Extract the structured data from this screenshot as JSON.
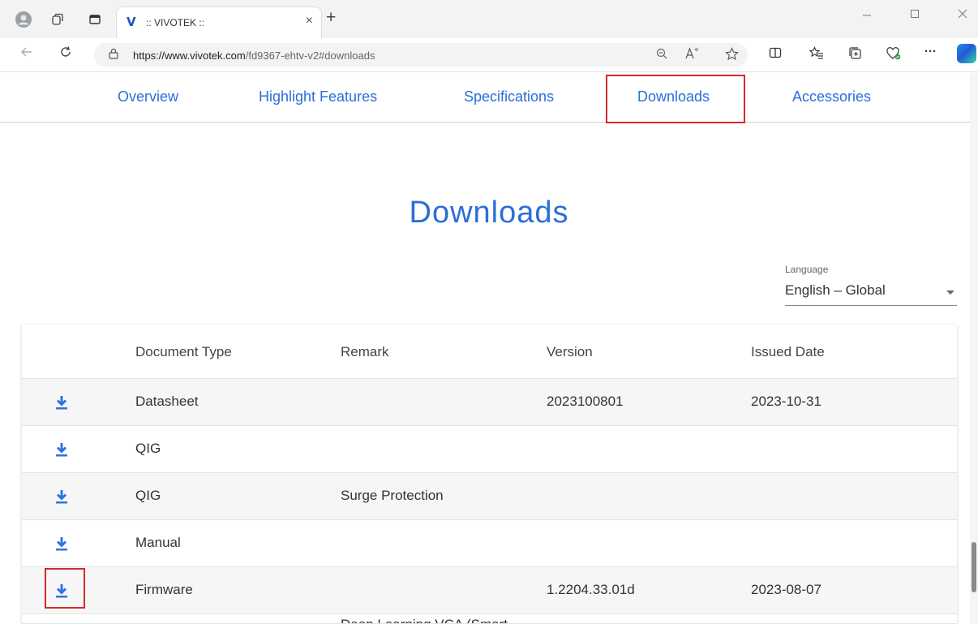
{
  "browser": {
    "tab_logo": "V",
    "tab_title": ":: VIVOTEK ::",
    "tab_close": "×",
    "new_tab": "+",
    "url_host": "https://www.vivotek.com",
    "url_path": "/fd9367-ehtv-v2#downloads",
    "more_tools": "···"
  },
  "site_nav": [
    "Overview",
    "Highlight Features",
    "Specifications",
    "Downloads",
    "Accessories"
  ],
  "page": {
    "heading": "Downloads"
  },
  "language": {
    "label": "Language",
    "value": "English – Global"
  },
  "table": {
    "headers": [
      "Document Type",
      "Remark",
      "Version",
      "Issued Date"
    ],
    "rows": [
      {
        "type": "Datasheet",
        "remark": "",
        "version": "2023100801",
        "date": "2023-10-31"
      },
      {
        "type": "QIG",
        "remark": "",
        "version": "",
        "date": ""
      },
      {
        "type": "QIG",
        "remark": "Surge Protection",
        "version": "",
        "date": ""
      },
      {
        "type": "Manual",
        "remark": "",
        "version": "",
        "date": ""
      },
      {
        "type": "Firmware",
        "remark": "",
        "version": "1.2204.33.01d",
        "date": "2023-08-07"
      },
      {
        "type": "",
        "remark": "Deep Learning VCA (Smart",
        "version": "",
        "date": ""
      }
    ]
  },
  "colors": {
    "accent": "#2b6ed8",
    "highlight": "#d42a2a",
    "download_icon": "#2f74e0"
  }
}
